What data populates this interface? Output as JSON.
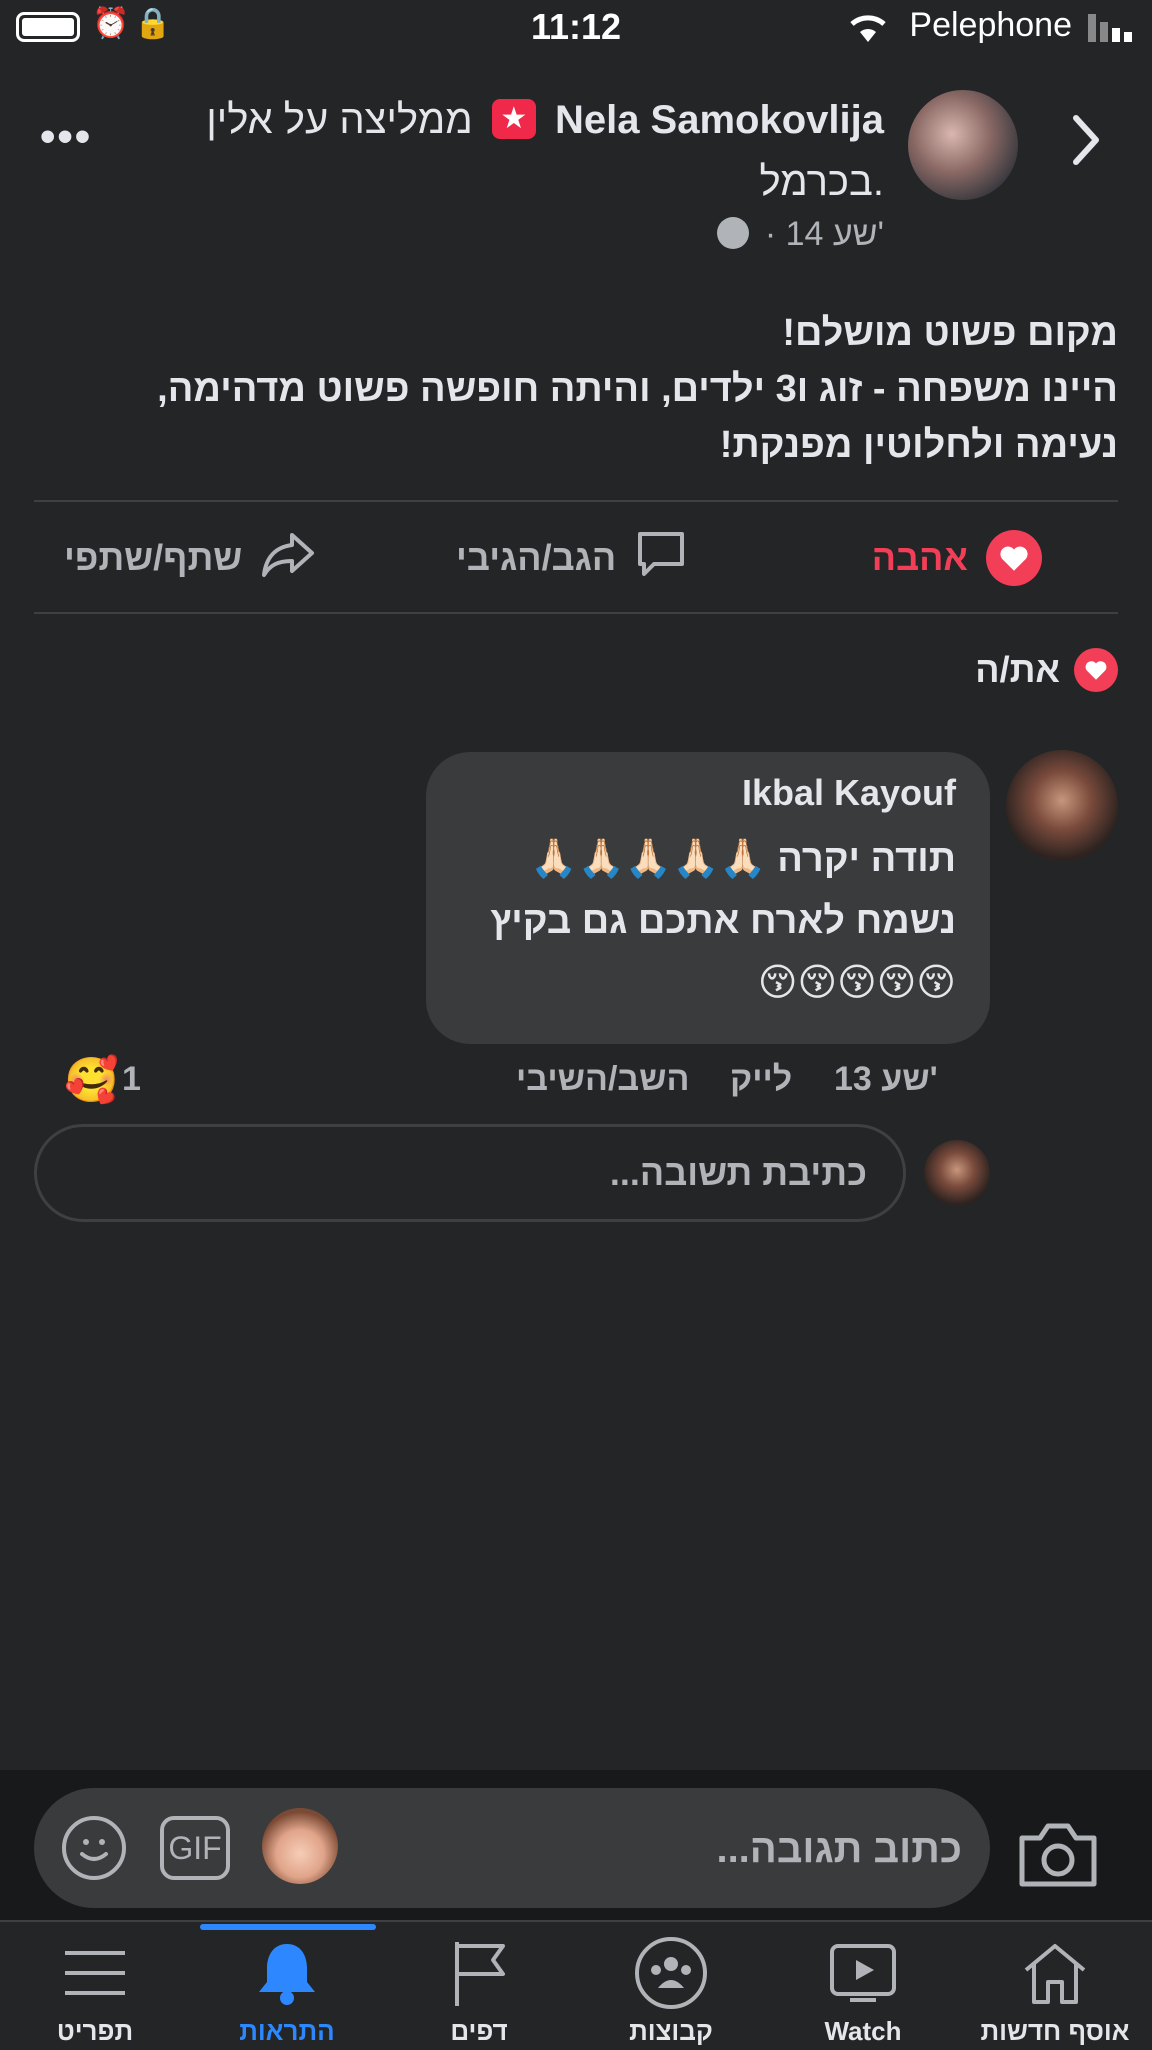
{
  "status_bar": {
    "time": "11:12",
    "carrier": "Pelephone"
  },
  "post": {
    "author": "Nela Samokovlija",
    "recommends_text": "ממליצה על אלין",
    "location_line": "בכרמל.",
    "time_ago": "14 שע'",
    "body_lines": [
      "מקום פשוט מושלם!",
      "היינו משפחה - זוג ו3 ילדים, והיתה חופשה פשוט מדהימה,",
      "נעימה ולחלוטין מפנקת!"
    ],
    "actions": {
      "love_label": "אהבה",
      "comment_label": "הגב/הגיבי",
      "share_label": "שתף/שתפי"
    },
    "reactors_text": "את/ה"
  },
  "comment": {
    "author": "Ikbal  Kayouf",
    "lines": [
      "תודה יקרה 🙏🏻🙏🏻🙏🏻🙏🏻🙏🏻",
      "נשמח לארח אתכם גם בקיץ",
      "😚😚😚😚😚"
    ],
    "time_ago": "13 שע'",
    "like_label": "לייק",
    "reply_label": "השב/השיבי",
    "reaction_emoji": "🥰",
    "reaction_count": "1"
  },
  "reply_box": {
    "placeholder": "כתיבת תשובה..."
  },
  "composer": {
    "placeholder": "כתוב תגובה...",
    "gif_label": "GIF"
  },
  "bottom_nav": {
    "items": [
      {
        "label": "תפריט",
        "icon": "menu-icon"
      },
      {
        "label": "התראות",
        "icon": "bell-icon",
        "active": true
      },
      {
        "label": "דפים",
        "icon": "flag-icon"
      },
      {
        "label": "קבוצות",
        "icon": "groups-icon"
      },
      {
        "label": "Watch",
        "icon": "watch-icon"
      },
      {
        "label": "אוסף חדשות",
        "icon": "home-icon"
      }
    ]
  },
  "colors": {
    "background": "#242526",
    "love": "#f33e58",
    "accent": "#2d88ff"
  }
}
